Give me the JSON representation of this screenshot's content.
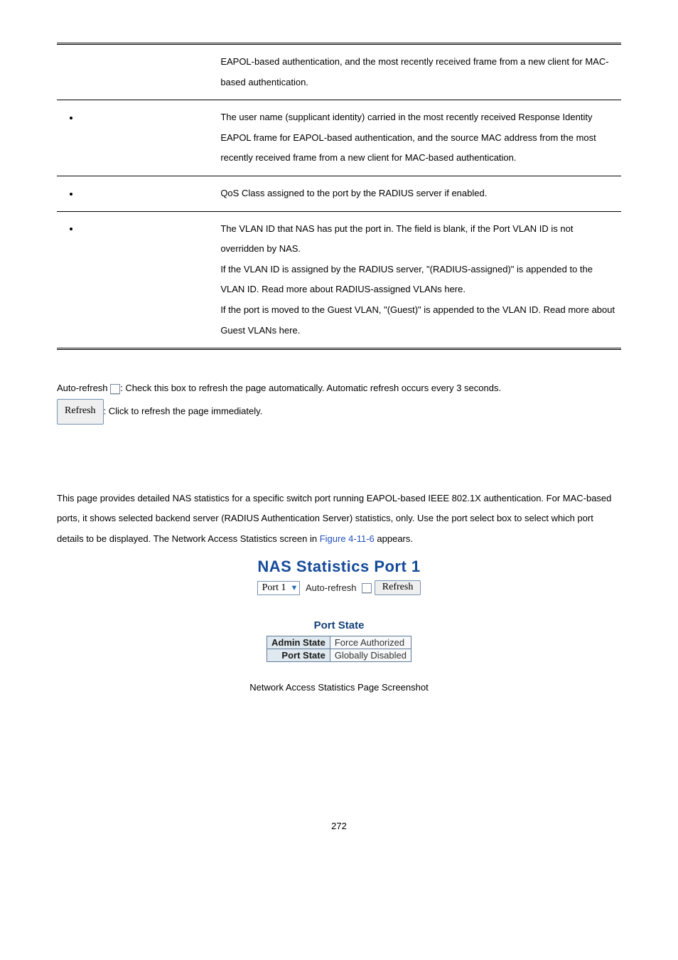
{
  "table": {
    "rows": [
      {
        "left": "",
        "right": "EAPOL-based authentication, and the most recently received frame from a new client for MAC-based authentication."
      },
      {
        "left": "bullet",
        "right": "The user name (supplicant identity) carried in the most recently received Response Identity EAPOL frame for EAPOL-based authentication, and the source MAC address from the most recently received frame from a new client for MAC-based authentication."
      },
      {
        "left": "bullet",
        "right": "QoS Class assigned to the port by the RADIUS server if enabled."
      },
      {
        "left": "bullet",
        "right": "The VLAN ID that NAS has put the port in. The field is blank, if the Port VLAN ID is not overridden by NAS.\nIf the VLAN ID is assigned by the RADIUS server, \"(RADIUS-assigned)\" is appended to the VLAN ID. Read more about RADIUS-assigned VLANs here.\nIf the port is moved to the Guest VLAN, \"(Guest)\" is appended to the VLAN ID. Read more about Guest VLANs here."
      }
    ]
  },
  "auto_refresh": {
    "label": "Auto-refresh",
    "desc": ": Check this box to refresh the page automatically. Automatic refresh occurs every 3 seconds."
  },
  "refresh_btn": {
    "label": "Refresh",
    "desc": ": Click to refresh the page immediately."
  },
  "section_para": {
    "pre": "This page provides detailed NAS statistics for a specific switch port running EAPOL-based IEEE 802.1X authentication. For MAC-based ports, it shows selected backend server (RADIUS Authentication Server) statistics, only. Use the port select box to select which port details to be displayed. The Network Access Statistics screen in ",
    "link": "Figure 4-11-6",
    "post": " appears."
  },
  "screenshot": {
    "title": "NAS Statistics  Port 1",
    "port_select": "Port 1",
    "auto_label": "Auto-refresh",
    "refresh_label": "Refresh",
    "sub": "Port State",
    "row1_h": "Admin State",
    "row1_v": "Force Authorized",
    "row2_h": "Port State",
    "row2_v": "Globally Disabled",
    "caption": "Network Access Statistics Page Screenshot"
  },
  "pagenum": "272"
}
